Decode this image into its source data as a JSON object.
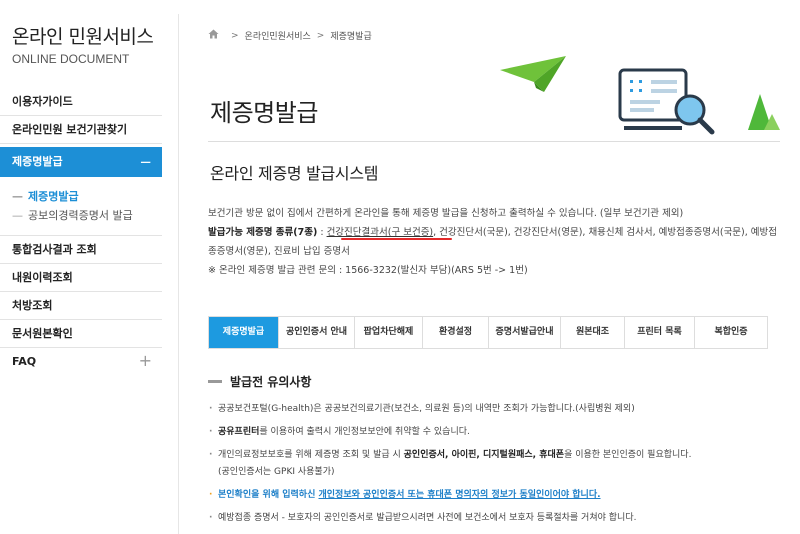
{
  "sidebar": {
    "title": "온라인 민원서비스",
    "subtitle": "ONLINE DOCUMENT",
    "items": [
      {
        "label": "이용자가이드"
      },
      {
        "label": "온라인민원 보건기관찾기"
      },
      {
        "label": "제증명발급",
        "expanded_icon": "−"
      },
      {
        "label": "통합검사결과 조회"
      },
      {
        "label": "내원이력조회"
      },
      {
        "label": "처방조회"
      },
      {
        "label": "문서원본확인"
      },
      {
        "label": "FAQ",
        "collapsed_icon": "+"
      }
    ],
    "sub_items": [
      {
        "label": "제증명발급",
        "current": true
      },
      {
        "label": "공보의경력증명서 발급",
        "current": false
      }
    ],
    "dash": "—"
  },
  "breadcrumb": {
    "home_icon": "home-icon",
    "items": [
      "온라인민원서비스",
      "제증명발급"
    ],
    "sep": ">"
  },
  "page": {
    "title": "제증명발급",
    "section_title": "온라인 제증명 발급시스템",
    "desc1": "보건기관 방문 없이 집에서 간편하게 온라인을 통해 제증명 발급을 신청하고 출력하실 수 있습니다. (일부 보건기관 제외)",
    "desc2_label": "발급가능 제증명 종류(7종)",
    "desc2_colon": " : ",
    "desc2_highlight": "건강진단결과서(구 보건증)",
    "desc2_rest": ", 건강진단서(국문), 건강진단서(영문), 채용신체 검사서, 예방접종증명서(국문), 예방접종증명서(영문), 진료비 납입 증명서",
    "desc3": "※ 온라인 제증명 발급 관련 문의 : 1566-3232(발신자 부담)(ARS 5번 -> 1번)"
  },
  "tabs": [
    "제증명발급",
    "공인인증서 안내",
    "팝업차단해제",
    "환경설정",
    "증명서발급안내",
    "원본대조",
    "프린터 목록",
    "복합인증"
  ],
  "notice": {
    "title": "발급전 유의사항",
    "items": {
      "n1": "공공보건포털(G-health)은 공공보건의료기관(보건소, 의료원 등)의 내역만 조회가 가능합니다.(사립병원 제외)",
      "n2_bold": "공유프린터",
      "n2_rest": "를 이용하여 출력시 개인정보보안에 취약할 수 있습니다.",
      "n3_a": "개인의료정보보호를 위해 제증명 조회 및 발급 시 ",
      "n3_b": "공인인증서, 아이핀, 디지털원패스, 휴대폰",
      "n3_c": "을 이용한 본인인증이 필요합니다.",
      "n3_d": "(공인인증서는 GPKI 사용불가)",
      "n4_a": "본인확인을 위해 입력하신 ",
      "n4_u": "개인정보와 공인인증서 또는 휴대폰 명의자의 정보가 동일인이어야 합니다.",
      "n5": "예방접종 증명서 - 보호자의 공인인증서로 발급받으시려면 사전에 보건소에서 보호자 등록절차를 거쳐야 합니다."
    }
  },
  "colors": {
    "accent": "#1d8fd6",
    "tab_active": "#1d9ae0",
    "highlight_mark": "#e32a2a",
    "notice_blue": "#1d7fc8"
  }
}
